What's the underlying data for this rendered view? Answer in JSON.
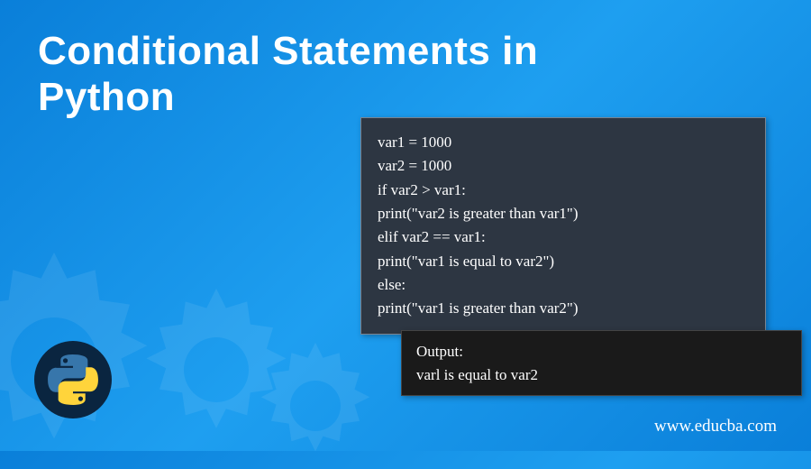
{
  "title_line1": "Conditional Statements in",
  "title_line2": "Python",
  "code_lines": [
    "var1 = 1000",
    "var2 = 1000",
    "if var2 > var1:",
    "print(\"var2 is greater than var1\")",
    "elif var2 == var1:",
    "print(\"var1 is equal to var2\")",
    "else:",
    "print(\"var1 is greater than var2\")"
  ],
  "output_lines": [
    "Output:",
    "varl is equal to var2"
  ],
  "website": "www.educba.com",
  "colors": {
    "bg_start": "#0a7fd9",
    "bg_end": "#1e9ff0",
    "code_bg": "#2d3642",
    "output_bg": "#1a1a1a",
    "badge_bg": "#0a2540"
  }
}
